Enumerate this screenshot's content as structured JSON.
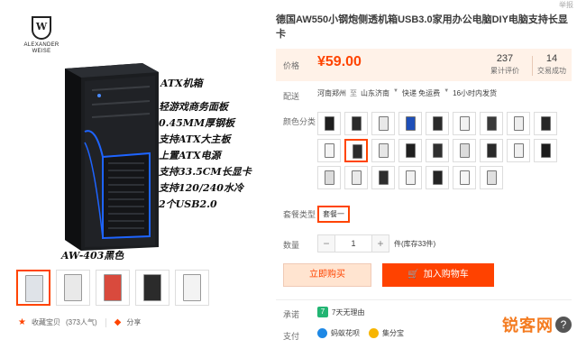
{
  "brand": {
    "line1": "ALEXANDER",
    "line2": "WEISE"
  },
  "photo": {
    "features_heading": "ATX机箱",
    "features": [
      "轻游戏商务面板",
      "0.45MM厚钢板",
      "支持ATX大主板",
      "上置ATX电源",
      "支持33.5CM长显卡",
      "支持120/240水冷",
      "2个USB2.0"
    ],
    "model_caption": "AW-403黑色"
  },
  "thumbnails": [
    {
      "body": "#dfe3e8"
    },
    {
      "body": "#e9e9e9"
    },
    {
      "body": "#d94a3d"
    },
    {
      "body": "#2b2b2b"
    },
    {
      "body": "#f3f3f3"
    }
  ],
  "social": {
    "favorite": "收藏宝贝",
    "fav_count": "(373人气)",
    "share": "分享"
  },
  "report": "举报",
  "product": {
    "title": "德国AW550小钢炮侧透机箱USB3.0家用办公电脑DIY电脑支持长显卡",
    "price_label": "价格",
    "price": "¥59.00",
    "reviews": {
      "value": "237",
      "label": "累计评价"
    },
    "sales": {
      "value": "14",
      "label": "交易成功"
    }
  },
  "delivery": {
    "label": "配送",
    "from": "河南郑州",
    "to_prefix": "至",
    "to": "山东济南",
    "express": "快递 免运费",
    "ship_time": "16小时内发货"
  },
  "colors": {
    "label": "颜色分类",
    "rows": [
      [
        "#1f1f1f",
        "#2a2a2a",
        "#e8e8e8",
        "#1e4fb8",
        "#2b2b2b",
        "#f2f2f2",
        "#3a3a3a",
        "#eeeeee",
        "#262626",
        "#333333"
      ],
      [
        "#f4f4f4",
        "#2c2c2c",
        "#e6e6e6",
        "#202020",
        "#303030",
        "#dcdcdc",
        "#2a2a2a",
        "#f0f0f0",
        "#1c1c1c",
        "#e4e4e4"
      ],
      [
        "#dcdcdc",
        "#eaeaea",
        "#2e2e2e",
        "#f1f1f1",
        "#242424",
        "#f5f5f5",
        "#e0e0e0"
      ]
    ]
  },
  "package": {
    "label": "套餐类型",
    "option": "套餐一"
  },
  "quantity": {
    "label": "数量",
    "minus": "−",
    "value": "1",
    "plus": "+",
    "unit": "件(库存33件)"
  },
  "buttons": {
    "buy_now": "立即购买",
    "add_cart": "加入购物车"
  },
  "promise": {
    "label": "承诺",
    "badge": "7",
    "text": "7天无理由"
  },
  "payment": {
    "label": "支付",
    "method1": "蚂蚁花呗",
    "method2": "集分宝"
  },
  "watermark": {
    "text": "锐客网",
    "mark": "?"
  },
  "accent": "#ff4400"
}
